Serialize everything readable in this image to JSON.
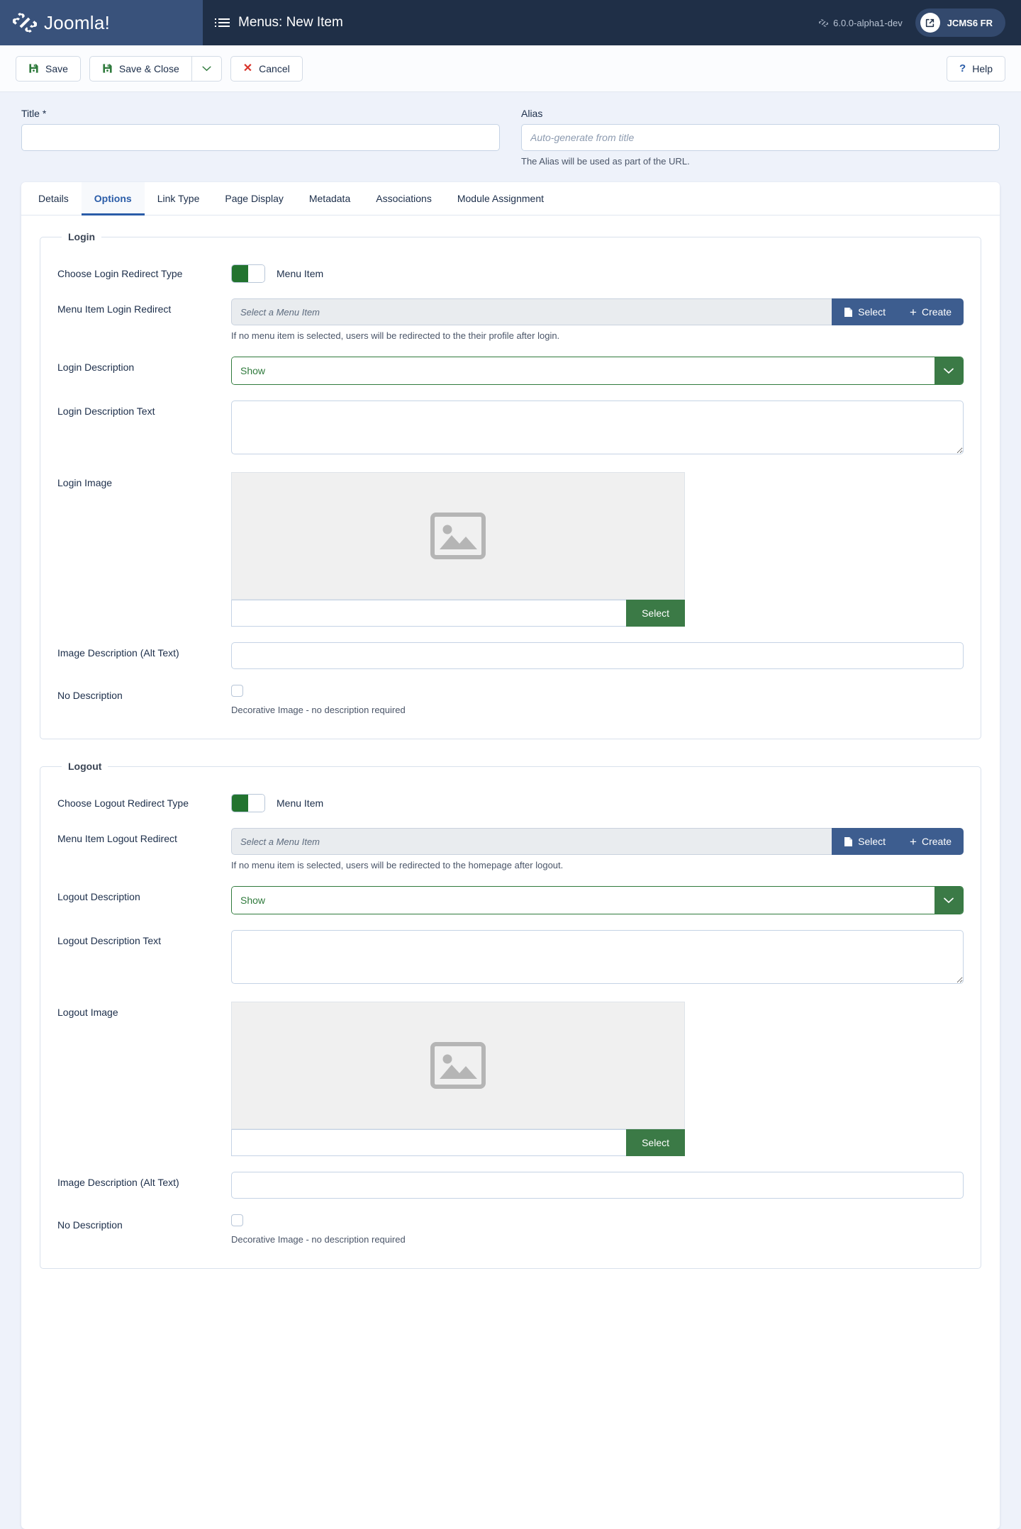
{
  "header": {
    "brand": "Joomla!",
    "brand_mark": "joomla-logo-icon",
    "page_title": "Menus: New Item",
    "menu_icon": "list-icon",
    "version": "6.0.0-alpha1-dev",
    "version_icon": "joomla-mark-icon",
    "site_name": "JCMS6 FR",
    "site_icon": "external-link-icon"
  },
  "toolbar": {
    "save_label": "Save",
    "save_icon": "floppy-disk-icon",
    "save_close_label": "Save & Close",
    "save_close_icon": "floppy-disk-icon",
    "dropdown_icon": "chevron-down-icon",
    "cancel_label": "Cancel",
    "cancel_icon": "close-x-icon",
    "help_label": "Help",
    "help_icon": "question-mark-icon"
  },
  "title_field": {
    "label": "Title *",
    "value": "",
    "placeholder": ""
  },
  "alias_field": {
    "label": "Alias",
    "value": "",
    "placeholder": "Auto-generate from title",
    "help": "The Alias will be used as part of the URL."
  },
  "tabs": [
    {
      "label": "Details",
      "active": false
    },
    {
      "label": "Options",
      "active": true
    },
    {
      "label": "Link Type",
      "active": false
    },
    {
      "label": "Page Display",
      "active": false
    },
    {
      "label": "Metadata",
      "active": false
    },
    {
      "label": "Associations",
      "active": false
    },
    {
      "label": "Module Assignment",
      "active": false
    }
  ],
  "login": {
    "legend": "Login",
    "redirect_type": {
      "label": "Choose Login Redirect Type",
      "toggle_state": "on",
      "value": "Menu Item"
    },
    "redirect": {
      "label": "Menu Item Login Redirect",
      "placeholder": "Select a Menu Item",
      "select_label": "Select",
      "select_icon": "document-icon",
      "create_label": "Create",
      "create_icon": "plus-icon",
      "help": "If no menu item is selected, users will be redirected to the their profile after login."
    },
    "description": {
      "label": "Login Description",
      "value": "Show",
      "chevron_icon": "chevron-down-icon"
    },
    "description_text": {
      "label": "Login Description Text",
      "value": ""
    },
    "image": {
      "label": "Login Image",
      "placeholder_icon": "image-placeholder-icon",
      "path_value": "",
      "select_label": "Select"
    },
    "alt_text": {
      "label": "Image Description (Alt Text)",
      "value": ""
    },
    "no_description": {
      "label": "No Description",
      "checked": false,
      "help": "Decorative Image - no description required"
    }
  },
  "logout": {
    "legend": "Logout",
    "redirect_type": {
      "label": "Choose Logout Redirect Type",
      "toggle_state": "on",
      "value": "Menu Item"
    },
    "redirect": {
      "label": "Menu Item Logout Redirect",
      "placeholder": "Select a Menu Item",
      "select_label": "Select",
      "select_icon": "document-icon",
      "create_label": "Create",
      "create_icon": "plus-icon",
      "help": "If no menu item is selected, users will be redirected to the homepage after logout."
    },
    "description": {
      "label": "Logout Description",
      "value": "Show",
      "chevron_icon": "chevron-down-icon"
    },
    "description_text": {
      "label": "Logout Description Text",
      "value": ""
    },
    "image": {
      "label": "Logout Image",
      "placeholder_icon": "image-placeholder-icon",
      "path_value": "",
      "select_label": "Select"
    },
    "alt_text": {
      "label": "Image Description (Alt Text)",
      "value": ""
    },
    "no_description": {
      "label": "No Description",
      "checked": false,
      "help": "Decorative Image - no description required"
    }
  },
  "colors": {
    "brand_panel": "#39527b",
    "header": "#1f2f47",
    "accent_blue": "#2a5ca8",
    "modal_button": "#3d5d8f",
    "green": "#3b7a46",
    "toggle_on": "#22732f",
    "page_bg": "#eef2fa"
  }
}
